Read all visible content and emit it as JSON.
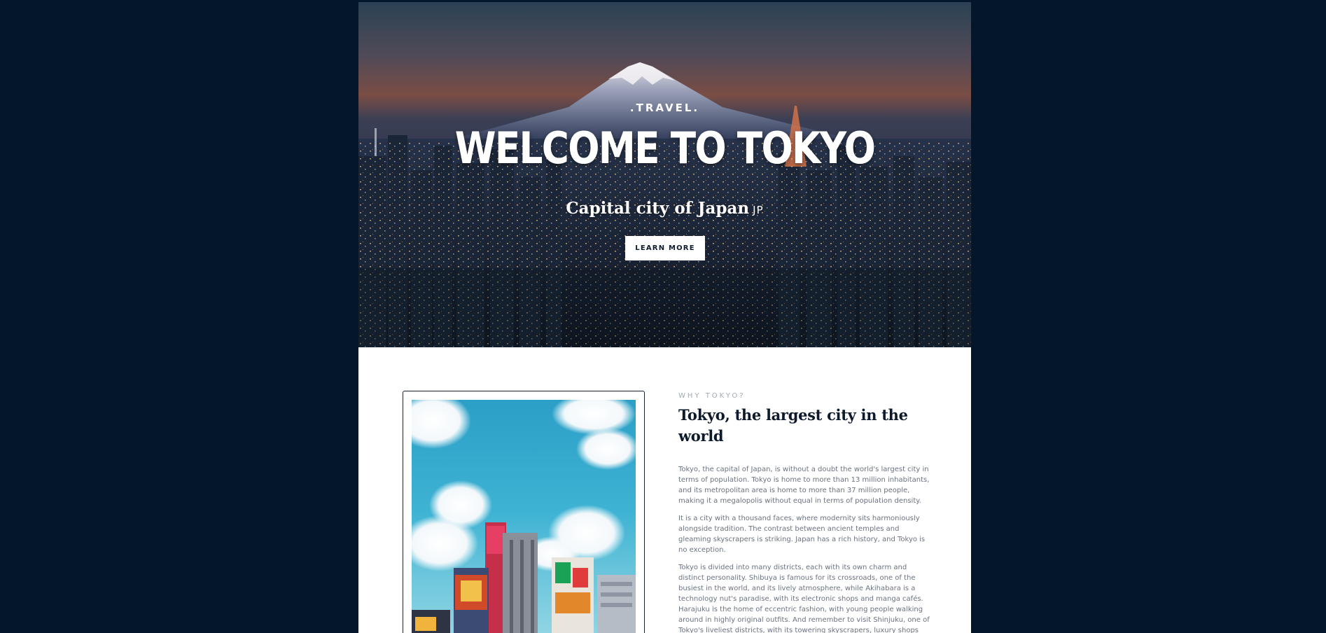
{
  "hero": {
    "eyebrow": ".TRAVEL.",
    "title": "WELCOME TO TOKYO",
    "subtitle": "Capital city of Japan",
    "country_code": "JP",
    "cta_label": "LEARN MORE",
    "background_image": "Mount Fuji behind the Tokyo skyline at dusk"
  },
  "about": {
    "kicker": "WHY TOKYO?",
    "title": "Tokyo, the largest city in the world",
    "image": "Shinjuku street with colorful billboards under a blue cloudy sky",
    "paragraphs": [
      "Tokyo, the capital of Japan, is without a doubt the world's largest city in terms of population. Tokyo is home to more than 13 million inhabitants, and its metropolitan area is home to more than 37 million people, making it a megalopolis without equal in terms of population density.",
      "It is a city with a thousand faces, where modernity sits harmoniously alongside tradition. The contrast between ancient temples and gleaming skyscrapers is striking. Japan has a rich history, and Tokyo is no exception.",
      "Tokyo is divided into many districts, each with its own charm and distinct personality. Shibuya is famous for its crossroads, one of the busiest in the world, and its lively atmosphere, while Akihabara is a technology nut's paradise, with its electronic shops and manga cafés. Harajuku is the home of eccentric fashion, with young people walking around in highly original outfits. And remember to visit Shinjuku, one of Tokyo's liveliest districts, with its towering skyscrapers, luxury shops and famous Shinjuku Gyoen park for a break from the concrete jungle. At night, Tokyo comes alive with an entirely different kind of"
    ]
  },
  "colors": {
    "outer_background": "#03162a",
    "page_background": "#ffffff",
    "heading_dark": "#0d1a2b",
    "body_text": "#6b7280",
    "kicker_text": "#a4aab3",
    "frame_border": "#132338"
  }
}
